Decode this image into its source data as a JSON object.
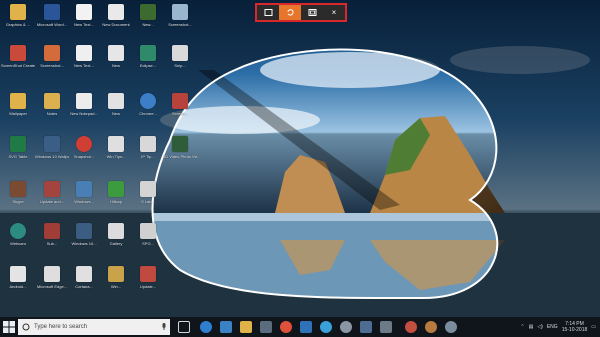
{
  "snip_toolbar": {
    "buttons": [
      {
        "name": "rectangular-snip",
        "icon": "rectangle-icon",
        "active": false
      },
      {
        "name": "freeform-snip",
        "icon": "freeform-icon",
        "active": true
      },
      {
        "name": "window-snip",
        "icon": "window-icon",
        "active": false
      },
      {
        "name": "close",
        "icon": "close-icon",
        "label": "×",
        "active": false
      }
    ],
    "border_color": "#d9282b",
    "active_color": "#e5762c"
  },
  "desktop_icons": [
    {
      "label": "Graphics & ..."
    },
    {
      "label": "Microsoft Word..."
    },
    {
      "label": "New Text..."
    },
    {
      "label": "New Document"
    },
    {
      "label": "New..."
    },
    {
      "label": "Screenshot..."
    },
    {
      "label": "ScreenShot Creates..."
    },
    {
      "label": "Screenshot..."
    },
    {
      "label": "New Text..."
    },
    {
      "label": "New"
    },
    {
      "label": "Eclipse..."
    },
    {
      "label": "Snip..."
    },
    {
      "label": "Wallpaper"
    },
    {
      "label": "Notes"
    },
    {
      "label": "New Notepad..."
    },
    {
      "label": "New"
    },
    {
      "label": "Chrome..."
    },
    {
      "label": "Screen..."
    },
    {
      "label": "SVG Table"
    },
    {
      "label": "Windows 10 Wallpapers..."
    },
    {
      "label": "Snapshot..."
    },
    {
      "label": "Win Tips..."
    },
    {
      "label": "IP Tip..."
    },
    {
      "label": "3D Video Photo Viewer"
    },
    {
      "label": "Skype"
    },
    {
      "label": "Update and..."
    },
    {
      "label": "Windows..."
    },
    {
      "label": "Hillcap"
    },
    {
      "label": "S Lab..."
    },
    {
      "label": "Webcam"
    },
    {
      "label": "Sub..."
    },
    {
      "label": "Windows 10..."
    },
    {
      "label": "Gallery"
    },
    {
      "label": "SPG..."
    },
    {
      "label": "Android..."
    },
    {
      "label": "Microsoft Edge..."
    },
    {
      "label": "Cortana..."
    },
    {
      "label": "Win..."
    },
    {
      "label": "Update..."
    }
  ],
  "taskbar": {
    "search_placeholder": "Type here to search",
    "tray": {
      "language": "ENG",
      "time": "7:14 PM",
      "date": "15-10-2018"
    }
  }
}
